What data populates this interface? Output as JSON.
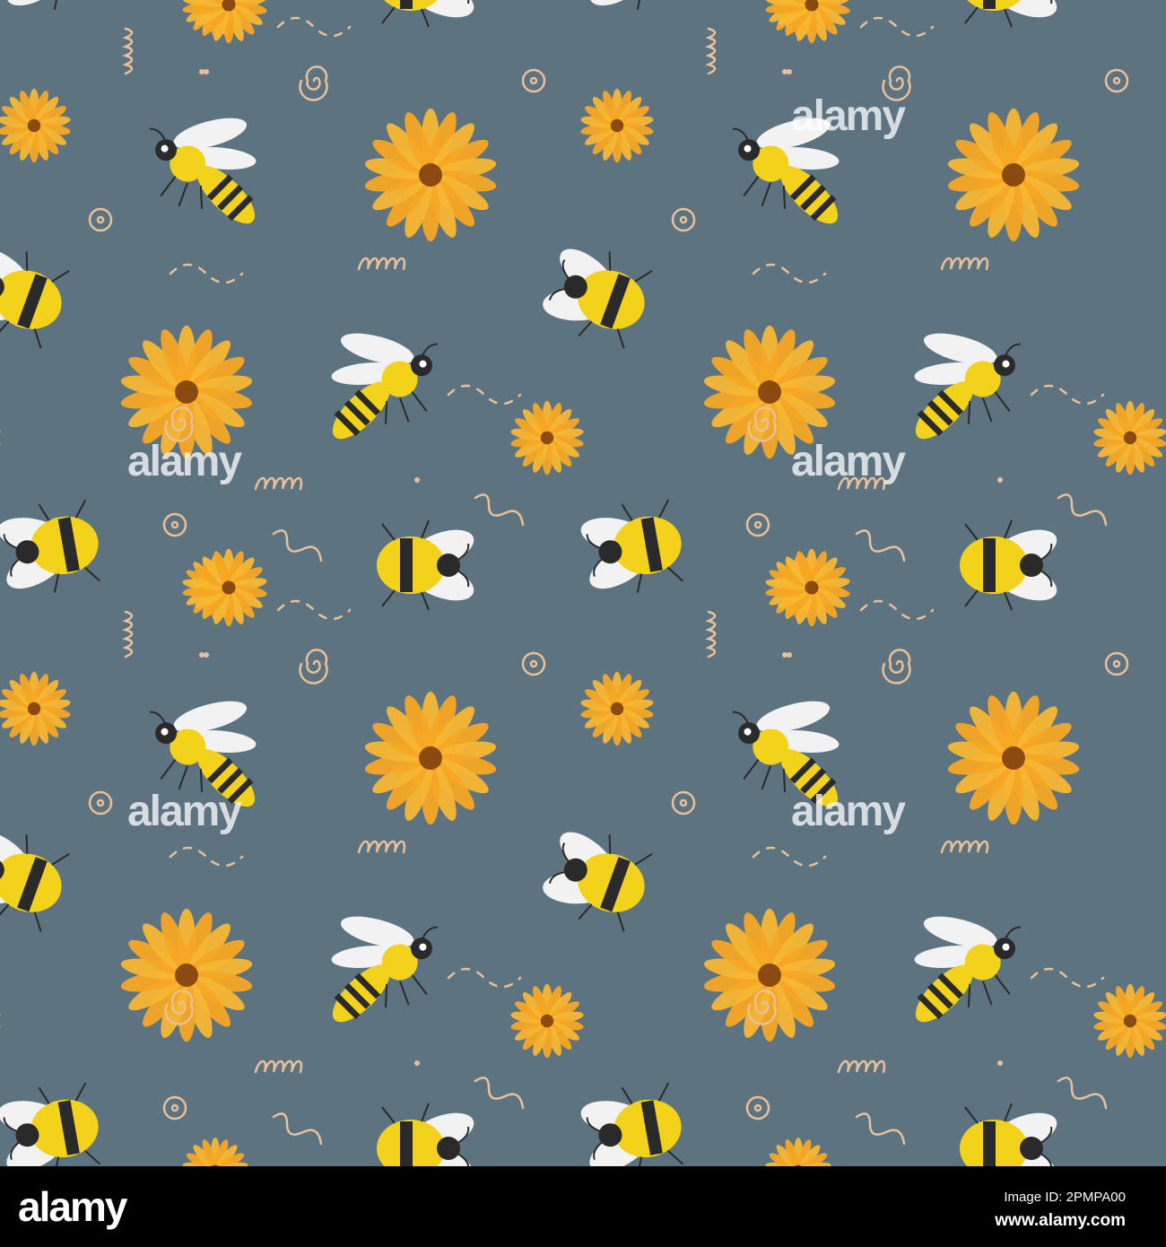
{
  "image": {
    "background_color": "#5e7380",
    "flower_color": "#f5a623",
    "flower_center_color": "#8a4a10",
    "bee_yellow": "#f2d21a",
    "bee_black": "#2a2a2a",
    "wing_color": "#f2f2f2",
    "doodle_color": "#e8c09a",
    "watermark_text": "alamy"
  },
  "footer": {
    "logo": "alamy",
    "image_id": "Image ID: 2PMPA00",
    "url": "www.alamy.com"
  }
}
